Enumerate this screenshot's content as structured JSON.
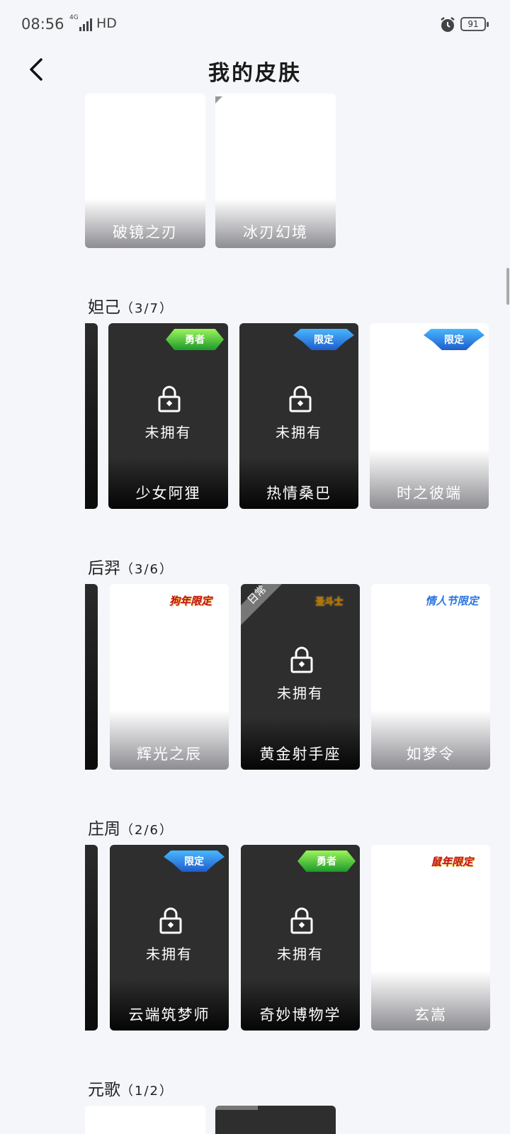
{
  "status_bar": {
    "time": "08:56",
    "network_tag": "4G",
    "network_label": "HD",
    "battery": "91"
  },
  "header": {
    "title": "我的皮肤"
  },
  "top_partial_cards": [
    {
      "name": "破镜之刃"
    },
    {
      "name": "冰刃幻境"
    }
  ],
  "sections": [
    {
      "title": "妲己",
      "count": "（3/7）",
      "cards": [
        {
          "name": "少女阿狸",
          "locked": true,
          "owned_text": "未拥有",
          "badge": "勇者"
        },
        {
          "name": "热情桑巴",
          "locked": true,
          "owned_text": "未拥有",
          "badge": "限定"
        },
        {
          "name": "时之彼端",
          "locked": false,
          "badge": "限定"
        }
      ]
    },
    {
      "title": "后羿",
      "count": "（3/6）",
      "cards": [
        {
          "name": "辉光之辰",
          "locked": false,
          "badge": "狗年限定"
        },
        {
          "name": "黄金射手座",
          "locked": true,
          "owned_text": "未拥有",
          "badge": "圣斗士",
          "corner_label": "日常"
        },
        {
          "name": "如梦令",
          "locked": false,
          "badge": "情人节限定"
        }
      ]
    },
    {
      "title": "庄周",
      "count": "（2/6）",
      "cards": [
        {
          "name": "云端筑梦师",
          "locked": true,
          "owned_text": "未拥有",
          "badge": "限定"
        },
        {
          "name": "奇妙博物学",
          "locked": true,
          "owned_text": "未拥有",
          "badge": "勇者"
        },
        {
          "name": "玄嵩",
          "locked": false,
          "badge": "鼠年限定"
        }
      ]
    },
    {
      "title": "元歌",
      "count": "（1/2）",
      "cards": []
    }
  ],
  "colors": {
    "background": "#f5f6fa",
    "card_dark": "#2e2e2e"
  }
}
